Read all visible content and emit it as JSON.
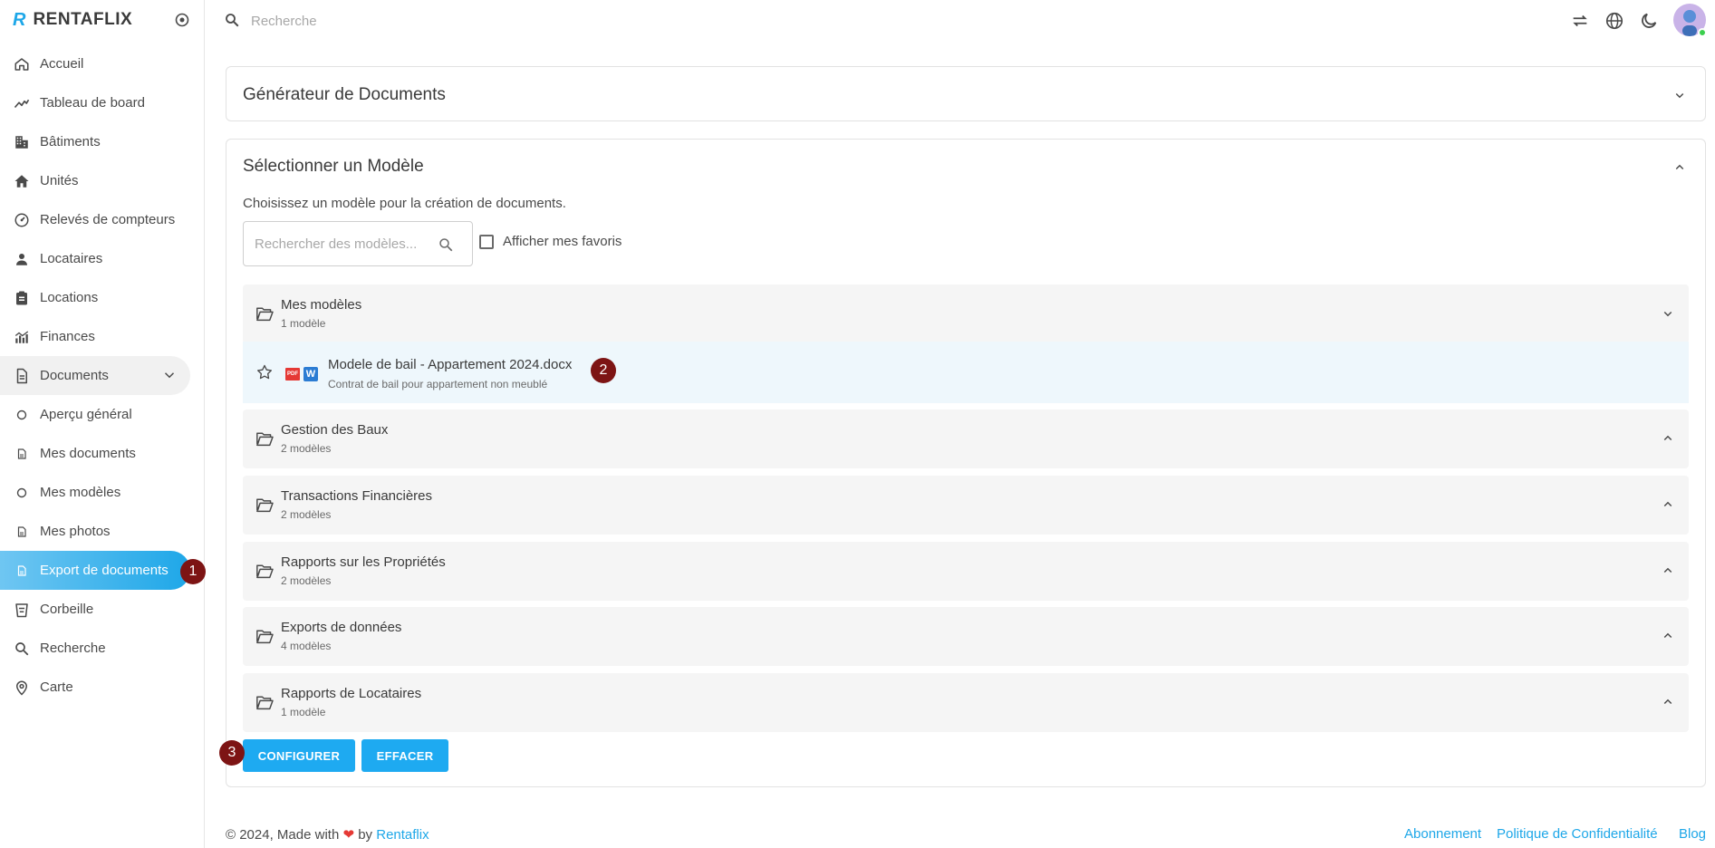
{
  "brand": {
    "logo": "R",
    "name": "RENTAFLIX"
  },
  "sidebar": {
    "items": [
      {
        "label": "Accueil",
        "icon": "home-icon"
      },
      {
        "label": "Tableau de board",
        "icon": "trending-icon"
      },
      {
        "label": "Bâtiments",
        "icon": "building-icon"
      },
      {
        "label": "Unités",
        "icon": "house-icon"
      },
      {
        "label": "Relevés de compteurs",
        "icon": "gauge-icon"
      },
      {
        "label": "Locataires",
        "icon": "person-icon"
      },
      {
        "label": "Locations",
        "icon": "clipboard-icon"
      },
      {
        "label": "Finances",
        "icon": "chart-icon"
      },
      {
        "label": "Documents",
        "icon": "document-icon"
      },
      {
        "label": "Aperçu général",
        "icon": "circle-icon"
      },
      {
        "label": "Mes documents",
        "icon": "file-icon"
      },
      {
        "label": "Mes modèles",
        "icon": "circle-icon"
      },
      {
        "label": "Mes photos",
        "icon": "file-icon"
      },
      {
        "label": "Export de documents",
        "icon": "file-icon"
      },
      {
        "label": "Corbeille",
        "icon": "trash-icon"
      },
      {
        "label": "Recherche",
        "icon": "search-icon"
      },
      {
        "label": "Carte",
        "icon": "map-pin-icon"
      }
    ]
  },
  "topbar": {
    "search_placeholder": "Recherche"
  },
  "generator": {
    "title": "Générateur de Documents"
  },
  "selector": {
    "title": "Sélectionner un Modèle",
    "description": "Choisissez un modèle pour la création de documents.",
    "search_placeholder": "Rechercher des modèles...",
    "favorites_label": "Afficher mes favoris",
    "groups": [
      {
        "name": "Mes modèles",
        "count": "1 modèle"
      },
      {
        "name": "Gestion des Baux",
        "count": "2 modèles"
      },
      {
        "name": "Transactions Financières",
        "count": "2 modèles"
      },
      {
        "name": "Rapports sur les Propriétés",
        "count": "2 modèles"
      },
      {
        "name": "Exports de données",
        "count": "4 modèles"
      },
      {
        "name": "Rapports de Locataires",
        "count": "1 modèle"
      }
    ],
    "template": {
      "name": "Modele de bail - Appartement 2024.docx",
      "description": "Contrat de bail pour appartement non meublé",
      "pdf_label": "PDF",
      "word_label": "W"
    },
    "configure_label": "CONFIGURER",
    "clear_label": "EFFACER"
  },
  "badges": [
    "1",
    "2",
    "3"
  ],
  "footer": {
    "prefix": "© 2024, Made with",
    "heart": "❤",
    "by": "by",
    "brand_link": "Rentaflix",
    "links": [
      "Abonnement",
      "Politique de Confidentialité",
      "Blog"
    ]
  },
  "colors": {
    "accent": "#1ea7e8",
    "badge": "#7d1414",
    "button": "#1eaaf1"
  }
}
